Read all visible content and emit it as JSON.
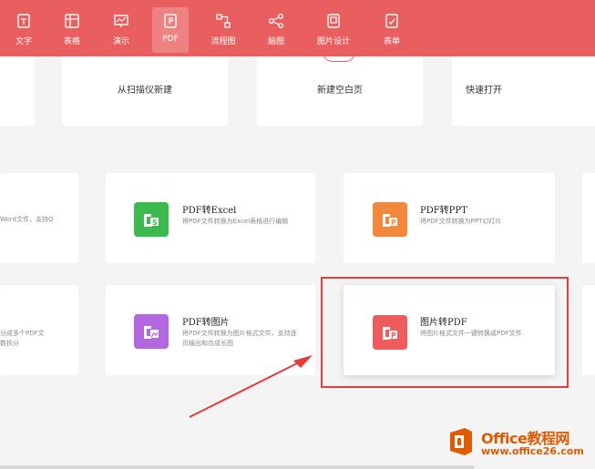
{
  "colors": {
    "toolbar": "#e95e5e",
    "excel_icon": "#3dba4e",
    "ppt_icon": "#f3873a",
    "image_icon": "#b468e0",
    "img2pdf_icon": "#ee5c5e",
    "highlight": "#e23c3c",
    "watermark": "#e05a00"
  },
  "toolbar": {
    "tabs": [
      {
        "label": "文字",
        "icon": "document-icon"
      },
      {
        "label": "表格",
        "icon": "table-icon"
      },
      {
        "label": "演示",
        "icon": "presentation-icon"
      },
      {
        "label": "PDF",
        "icon": "pdf-icon",
        "active": true
      },
      {
        "label": "流程图",
        "icon": "flowchart-icon"
      },
      {
        "label": "脑图",
        "icon": "mindmap-icon"
      },
      {
        "label": "图片设计",
        "icon": "image-design-icon"
      },
      {
        "label": "表单",
        "icon": "form-icon"
      }
    ]
  },
  "quick_actions": [
    {
      "label": "从扫描仪新建"
    },
    {
      "label": "新建空白页"
    },
    {
      "label": "快速打开"
    }
  ],
  "features": {
    "pdf_to_word_partial": {
      "desc": "Word文件，支持O"
    },
    "pdf_to_excel": {
      "title": "PDF转Excel",
      "desc": "将PDF文件转换为Excel表格进行编辑"
    },
    "pdf_to_ppt": {
      "title": "PDF转PPT",
      "desc": "将PDF文件转换为PPT幻灯片"
    },
    "pdf_split_partial": {
      "desc1": "分成多个PDF文",
      "desc2": "数拆分"
    },
    "pdf_to_image": {
      "title": "PDF转图片",
      "desc": "将PDF文件转换为图片格式文件，支持逐页输出和合成长图"
    },
    "image_to_pdf": {
      "title": "图片转PDF",
      "desc": "将图片格式文件一键转换成PDF文件"
    }
  },
  "watermark": {
    "title": "Office教程网",
    "url": "www.office26.com"
  }
}
